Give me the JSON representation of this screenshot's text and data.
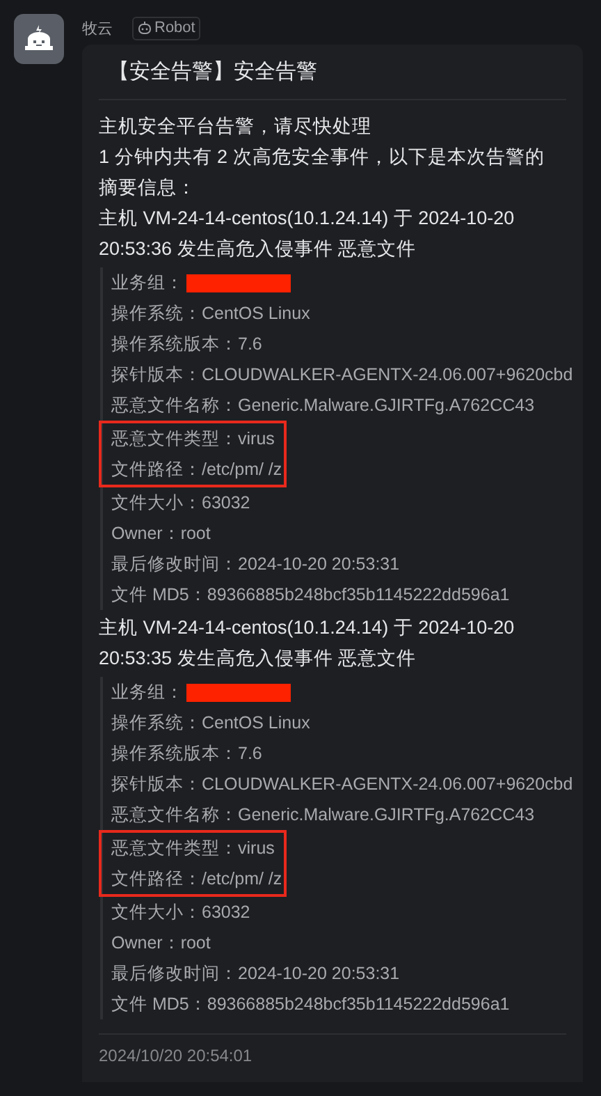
{
  "sender": {
    "name": "牧云",
    "tag": "Robot"
  },
  "message": {
    "title": "【安全告警】安全告警",
    "intro": [
      "主机安全平台告警，请尽快处理",
      "1 分钟内共有 2 次高危安全事件，以下是本次告警的摘要信息："
    ],
    "events": [
      {
        "heading": "主机 VM-24-14-centos(10.1.24.14) 于 2024-10-20 20:53:36 发生高危入侵事件 恶意文件",
        "fields": [
          {
            "kind": "redacted",
            "label": "业务组：",
            "highlighted": false
          },
          {
            "kind": "text",
            "label": "操作系统：",
            "value": "CentOS Linux",
            "highlighted": false
          },
          {
            "kind": "text",
            "label": "操作系统版本：",
            "value": "7.6",
            "highlighted": false
          },
          {
            "kind": "text",
            "label": "探针版本：",
            "value": "CLOUDWALKER-AGENTX-24.06.007+9620cbd",
            "highlighted": false
          },
          {
            "kind": "text",
            "label": "恶意文件名称：",
            "value": "Generic.Malware.GJIRTFg.A762CC43",
            "highlighted": false
          },
          {
            "kind": "text",
            "label": "恶意文件类型：",
            "value": "virus",
            "highlighted": true
          },
          {
            "kind": "text",
            "label": "文件路径：",
            "value": "/etc/pm/ /z",
            "highlighted": true
          },
          {
            "kind": "text",
            "label": "文件大小：",
            "value": "63032",
            "highlighted": false
          },
          {
            "kind": "text",
            "label": "Owner：",
            "value": "root",
            "highlighted": false
          },
          {
            "kind": "text",
            "label": "最后修改时间：",
            "value": "2024-10-20 20:53:31",
            "highlighted": false
          },
          {
            "kind": "text",
            "label": "文件 MD5：",
            "value": "89366885b248bcf35b1145222dd596a1",
            "highlighted": false
          }
        ]
      },
      {
        "heading": "主机 VM-24-14-centos(10.1.24.14) 于 2024-10-20 20:53:35 发生高危入侵事件 恶意文件",
        "fields": [
          {
            "kind": "redacted",
            "label": "业务组：",
            "highlighted": false
          },
          {
            "kind": "text",
            "label": "操作系统：",
            "value": "CentOS Linux",
            "highlighted": false
          },
          {
            "kind": "text",
            "label": "操作系统版本：",
            "value": "7.6",
            "highlighted": false
          },
          {
            "kind": "text",
            "label": "探针版本：",
            "value": "CLOUDWALKER-AGENTX-24.06.007+9620cbd",
            "highlighted": false
          },
          {
            "kind": "text",
            "label": "恶意文件名称：",
            "value": "Generic.Malware.GJIRTFg.A762CC43",
            "highlighted": false
          },
          {
            "kind": "text",
            "label": "恶意文件类型：",
            "value": "virus",
            "highlighted": true
          },
          {
            "kind": "text",
            "label": "文件路径：",
            "value": "/etc/pm/ /z",
            "highlighted": true
          },
          {
            "kind": "text",
            "label": "文件大小：",
            "value": "63032",
            "highlighted": false
          },
          {
            "kind": "text",
            "label": "Owner：",
            "value": "root",
            "highlighted": false
          },
          {
            "kind": "text",
            "label": "最后修改时间：",
            "value": "2024-10-20 20:53:31",
            "highlighted": false
          },
          {
            "kind": "text",
            "label": "文件 MD5：",
            "value": "89366885b248bcf35b1145222dd596a1",
            "highlighted": false
          }
        ]
      }
    ],
    "timestamp": "2024/10/20 20:54:01"
  }
}
